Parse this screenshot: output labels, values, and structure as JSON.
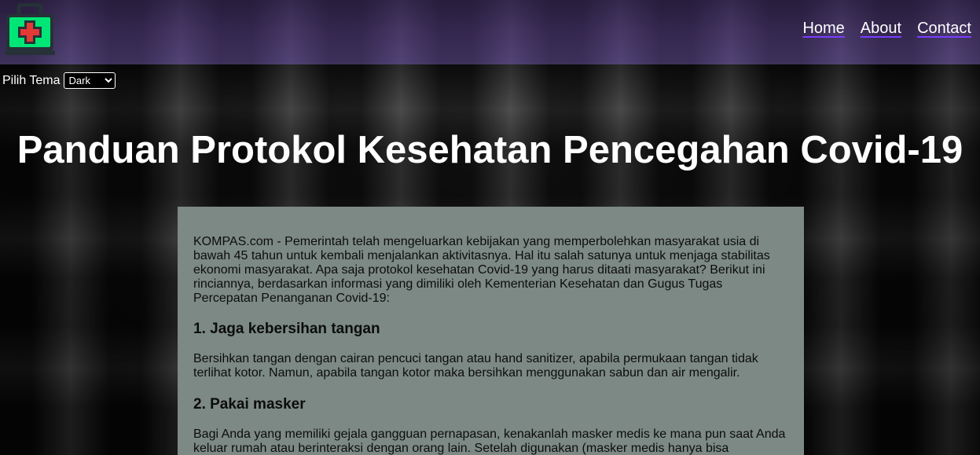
{
  "nav": {
    "links": [
      "Home",
      "About",
      "Contact"
    ]
  },
  "theme": {
    "label": "Pilih Tema",
    "selected": "Dark"
  },
  "title": "Panduan Protokol Kesehatan Pencegahan Covid-19",
  "article": {
    "intro": "KOMPAS.com - Pemerintah telah mengeluarkan kebijakan yang memperbolehkan masyarakat usia di bawah 45 tahun untuk kembali menjalankan aktivitasnya. Hal itu salah satunya untuk menjaga stabilitas ekonomi masyarakat. Apa saja protokol kesehatan Covid-19 yang harus ditaati masyarakat? Berikut ini rinciannya, berdasarkan informasi yang dimiliki oleh Kementerian Kesehatan dan Gugus Tugas Percepatan Penanganan Covid-19:",
    "sections": [
      {
        "heading": "1. Jaga kebersihan tangan",
        "body": "Bersihkan tangan dengan cairan pencuci tangan atau hand sanitizer, apabila permukaan tangan tidak terlihat kotor. Namun, apabila tangan kotor maka bersihkan menggunakan sabun dan air mengalir."
      },
      {
        "heading": "2. Pakai masker",
        "body": "Bagi Anda yang memiliki gejala gangguan pernapasan, kenakanlah masker medis ke mana pun saat Anda keluar rumah atau berinteraksi dengan orang lain. Setelah digunakan (masker medis hanya bisa"
      }
    ]
  },
  "colors": {
    "navbar": "#40325e",
    "article_bg": "#7c8985",
    "link_underline": "#7a3cff",
    "logo_body": "#00e676"
  },
  "icons": {
    "logo": "medical-bag-icon"
  }
}
